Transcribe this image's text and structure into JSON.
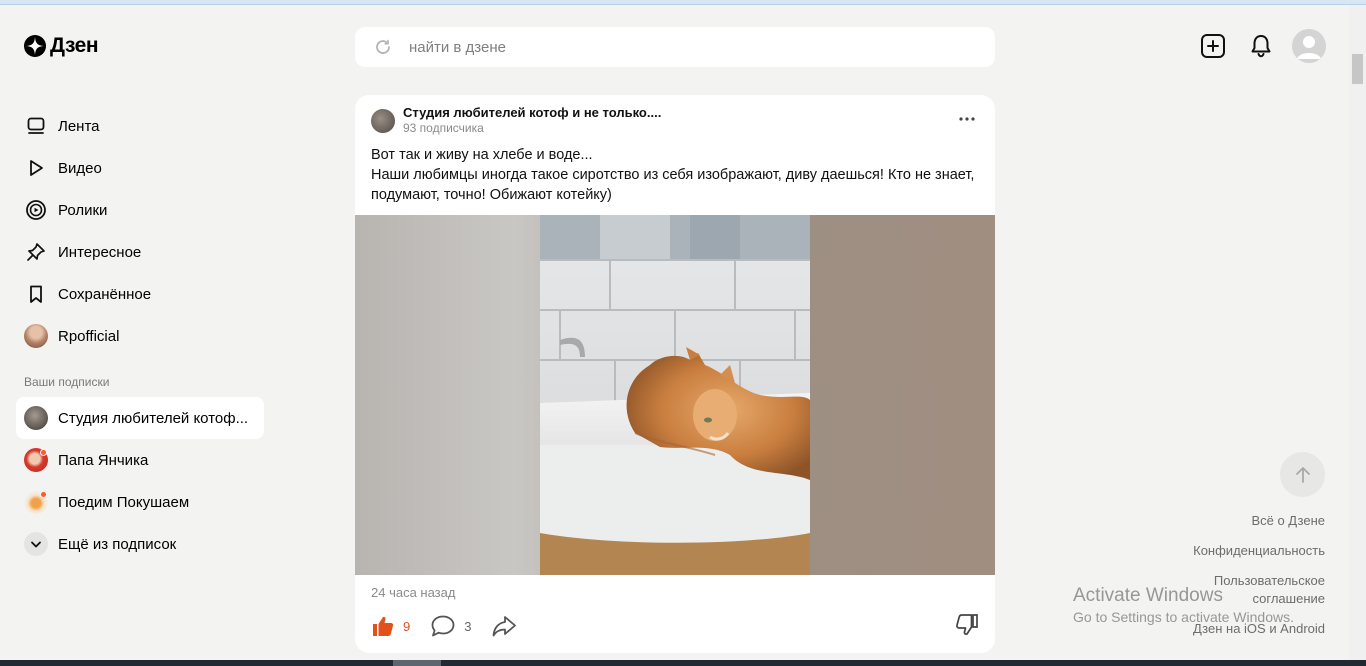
{
  "brand": {
    "name": "Дзен"
  },
  "search": {
    "placeholder": "найти в дзене"
  },
  "nav": {
    "items": [
      {
        "label": "Лента",
        "icon": "feed-icon"
      },
      {
        "label": "Видео",
        "icon": "play-icon"
      },
      {
        "label": "Ролики",
        "icon": "shorts-icon"
      },
      {
        "label": "Интересное",
        "icon": "pin-icon"
      },
      {
        "label": "Сохранённое",
        "icon": "bookmark-icon"
      },
      {
        "label": "Rpofficial",
        "icon": "avatar"
      }
    ],
    "subs_title": "Ваши подписки",
    "subs": [
      {
        "label": "Студия любителей котоф..."
      },
      {
        "label": "Папа Янчика"
      },
      {
        "label": "Поедим Покушаем"
      },
      {
        "label": "Ещё из подписок"
      }
    ]
  },
  "post": {
    "channel": "Студия любителей котоф и не только....",
    "subscribers": "93 подписчика",
    "text_line1": "Вот так и живу на хлебе и воде...",
    "text_line2": "Наши любимцы иногда такое сиротство из себя изображают, диву даешься! Кто не знает, подумают, точно! Обижают котейку)",
    "time": "24 часа назад",
    "likes": "9",
    "comments": "3"
  },
  "footer": {
    "about": "Всё о Дзене",
    "privacy": "Конфиденциальность",
    "terms": "Пользовательское соглашение",
    "apps": "Дзен на iOS и Android"
  },
  "watermark": {
    "title": "Activate Windows",
    "subtitle": "Go to Settings to activate Windows."
  },
  "colors": {
    "accent": "#e2501c",
    "background": "#f3f3f2",
    "card": "#ffffff"
  }
}
